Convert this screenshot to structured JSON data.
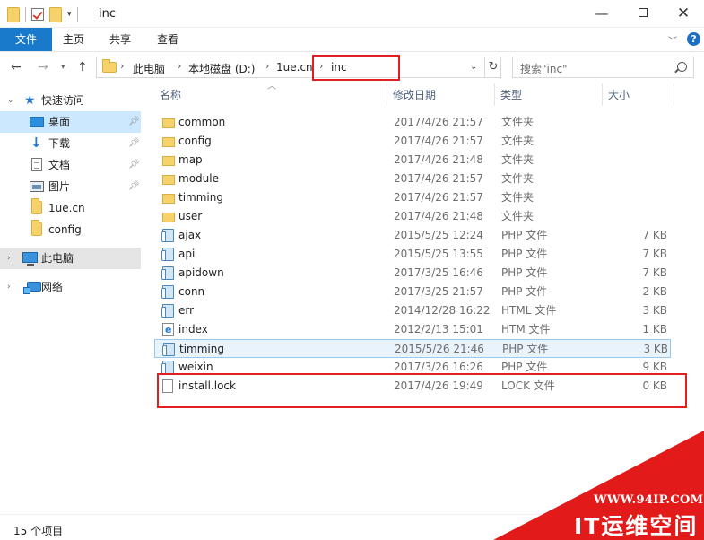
{
  "window": {
    "title": "inc",
    "minimize": "—",
    "close": "✕"
  },
  "ribbon": {
    "tabs": [
      "文件",
      "主页",
      "共享",
      "查看"
    ],
    "help": "?"
  },
  "address": {
    "crumbs": [
      "此电脑",
      "本地磁盘 (D:)",
      "1ue.cn",
      "inc"
    ]
  },
  "search": {
    "placeholder": "搜索\"inc\""
  },
  "sidebar": {
    "items": [
      {
        "label": "快速访问"
      },
      {
        "label": "桌面"
      },
      {
        "label": "下载"
      },
      {
        "label": "文档"
      },
      {
        "label": "图片"
      },
      {
        "label": "1ue.cn"
      },
      {
        "label": "config"
      },
      {
        "label": "此电脑"
      },
      {
        "label": "网络"
      }
    ]
  },
  "columns": {
    "name": "名称",
    "date": "修改日期",
    "type": "类型",
    "size": "大小"
  },
  "files": [
    {
      "name": "common",
      "date": "2017/4/26 21:57",
      "type": "文件夹",
      "size": "",
      "icon": "folder-icon"
    },
    {
      "name": "config",
      "date": "2017/4/26 21:57",
      "type": "文件夹",
      "size": "",
      "icon": "folder-icon"
    },
    {
      "name": "map",
      "date": "2017/4/26 21:48",
      "type": "文件夹",
      "size": "",
      "icon": "folder-icon"
    },
    {
      "name": "module",
      "date": "2017/4/26 21:57",
      "type": "文件夹",
      "size": "",
      "icon": "folder-icon"
    },
    {
      "name": "timming",
      "date": "2017/4/26 21:57",
      "type": "文件夹",
      "size": "",
      "icon": "folder-icon"
    },
    {
      "name": "user",
      "date": "2017/4/26 21:48",
      "type": "文件夹",
      "size": "",
      "icon": "folder-icon"
    },
    {
      "name": "ajax",
      "date": "2015/5/25 12:24",
      "type": "PHP 文件",
      "size": "7 KB",
      "icon": "php-file-icon"
    },
    {
      "name": "api",
      "date": "2015/5/25 13:55",
      "type": "PHP 文件",
      "size": "7 KB",
      "icon": "php-file-icon"
    },
    {
      "name": "apidown",
      "date": "2017/3/25 16:46",
      "type": "PHP 文件",
      "size": "7 KB",
      "icon": "php-file-icon"
    },
    {
      "name": "conn",
      "date": "2017/3/25 21:57",
      "type": "PHP 文件",
      "size": "2 KB",
      "icon": "php-file-icon"
    },
    {
      "name": "err",
      "date": "2014/12/28 16:22",
      "type": "HTML 文件",
      "size": "3 KB",
      "icon": "php-file-icon"
    },
    {
      "name": "index",
      "date": "2012/2/13 15:01",
      "type": "HTM 文件",
      "size": "1 KB",
      "icon": "html-file-icon"
    },
    {
      "name": "timming",
      "date": "2015/5/26 21:46",
      "type": "PHP 文件",
      "size": "3 KB",
      "icon": "php-file-icon"
    },
    {
      "name": "weixin",
      "date": "2017/3/26 16:26",
      "type": "PHP 文件",
      "size": "9 KB",
      "icon": "php-file-icon"
    },
    {
      "name": "install.lock",
      "date": "2017/4/26 19:49",
      "type": "LOCK 文件",
      "size": "0 KB",
      "icon": "lock-file-icon"
    }
  ],
  "status": {
    "count": "15 个项目"
  },
  "watermark": {
    "url": "WWW.94IP.COM",
    "brand": "IT运维空间"
  }
}
